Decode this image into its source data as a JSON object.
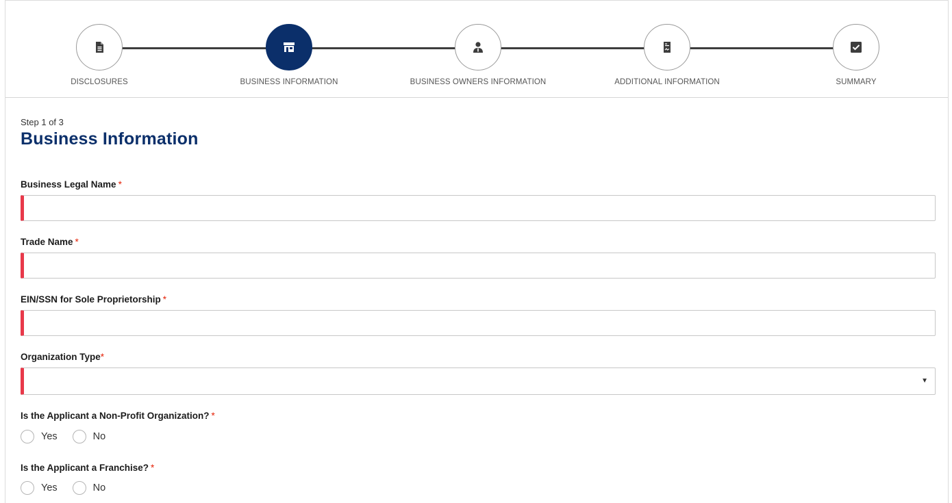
{
  "stepper": {
    "steps": [
      {
        "label": "DISCLOSURES",
        "icon": "document-icon",
        "active": false
      },
      {
        "label": "BUSINESS INFORMATION",
        "icon": "storefront-icon",
        "active": true
      },
      {
        "label": "BUSINESS OWNERS INFORMATION",
        "icon": "person-icon",
        "active": false
      },
      {
        "label": "ADDITIONAL INFORMATION",
        "icon": "signed-document-icon",
        "active": false
      },
      {
        "label": "SUMMARY",
        "icon": "checkbox-icon",
        "active": false
      }
    ]
  },
  "form": {
    "step_count": "Step 1 of 3",
    "title": "Business Information",
    "legal_name": {
      "label": "Business Legal Name",
      "required": "*",
      "value": ""
    },
    "trade_name": {
      "label": "Trade Name",
      "required": "*",
      "value": ""
    },
    "ein_ssn": {
      "label": "EIN/SSN for Sole Proprietorship",
      "required": "*",
      "value": ""
    },
    "org_type": {
      "label": "Organization Type",
      "required": "*",
      "value": ""
    },
    "non_profit": {
      "label": "Is the Applicant a Non-Profit Organization?",
      "required": "*",
      "options": [
        "Yes",
        "No"
      ]
    },
    "franchise": {
      "label": "Is the Applicant a Franchise?",
      "required": "*",
      "options": [
        "Yes",
        "No"
      ]
    }
  },
  "colors": {
    "primary": "#0b2f6a",
    "required": "#e52207",
    "error_border": "#e8394a"
  }
}
